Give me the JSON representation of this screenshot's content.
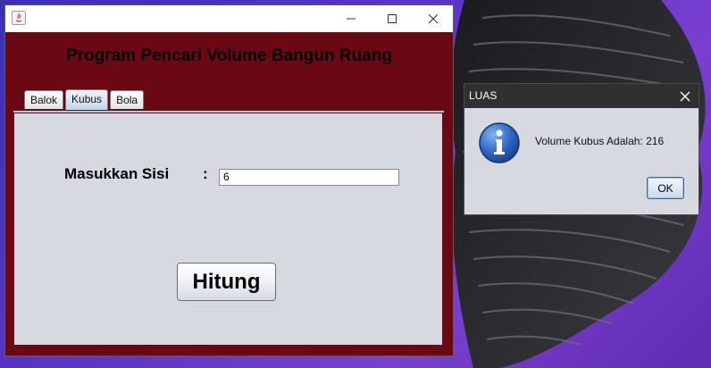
{
  "colors": {
    "window_background": "#6a0814",
    "panel_background": "#d6d9df",
    "dialog_titlebar": "#303030"
  },
  "main_window": {
    "title": "",
    "header_title": "Program Pencari Volume Bangun Ruang",
    "tabs": [
      {
        "label": "Balok",
        "selected": false
      },
      {
        "label": "Kubus",
        "selected": true
      },
      {
        "label": "Bola",
        "selected": false
      }
    ],
    "form": {
      "sisi_label": "Masukkan Sisi",
      "colon": ":",
      "sisi_value": "6",
      "hitung_label": "Hitung"
    }
  },
  "dialog": {
    "title": "LUAS",
    "icon": "info-icon",
    "message": "Volume Kubus Adalah: 216",
    "ok_label": "OK"
  }
}
